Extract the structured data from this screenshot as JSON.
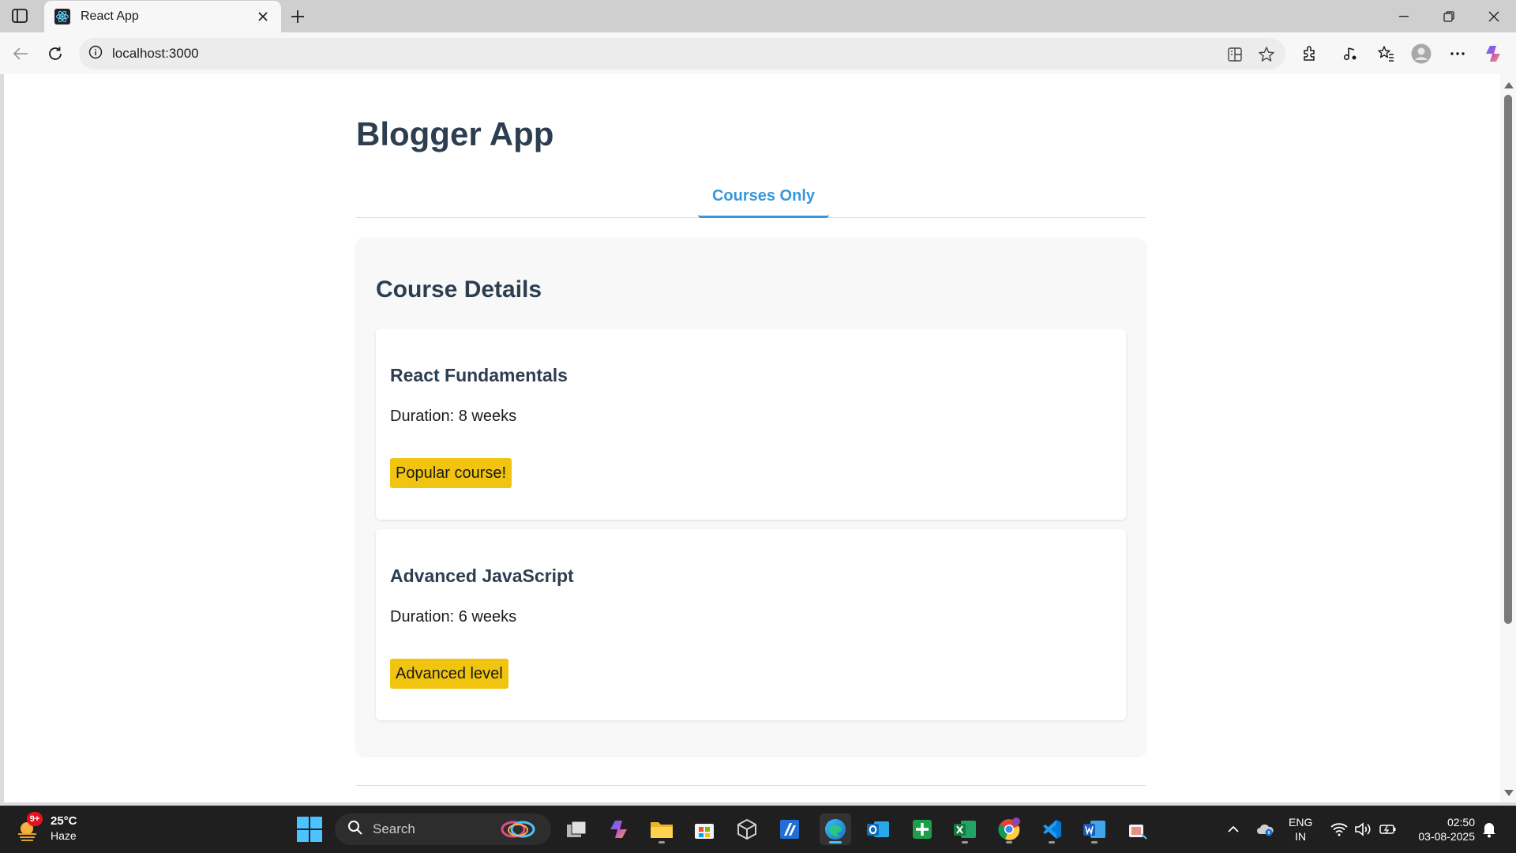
{
  "browser": {
    "tab_title": "React App",
    "url": "localhost:3000"
  },
  "app": {
    "title": "Blogger App",
    "active_tab": "Courses Only",
    "section_title": "Course Details",
    "courses": [
      {
        "name": "React Fundamentals",
        "duration": "Duration: 8 weeks",
        "badge": "Popular course!"
      },
      {
        "name": "Advanced JavaScript",
        "duration": "Duration: 6 weeks",
        "badge": "Advanced level"
      }
    ],
    "colors": {
      "heading": "#2c3e50",
      "accent": "#3498db",
      "badge": "#f1c40f"
    }
  },
  "taskbar": {
    "weather_temp": "25°C",
    "weather_condition": "Haze",
    "weather_badge": "9+",
    "search_label": "Search",
    "language_line1": "ENG",
    "language_line2": "IN",
    "time": "02:50",
    "date": "03-08-2025",
    "pinned_apps": [
      "task-view-icon",
      "copilot-icon",
      "file-explorer-icon",
      "microsoft-store-icon",
      "unity-icon",
      "azure-icon",
      "edge-icon",
      "outlook-icon",
      "add-app-icon",
      "excel-icon",
      "chrome-icon",
      "vscode-icon",
      "word-icon",
      "snipping-tool-icon"
    ]
  }
}
